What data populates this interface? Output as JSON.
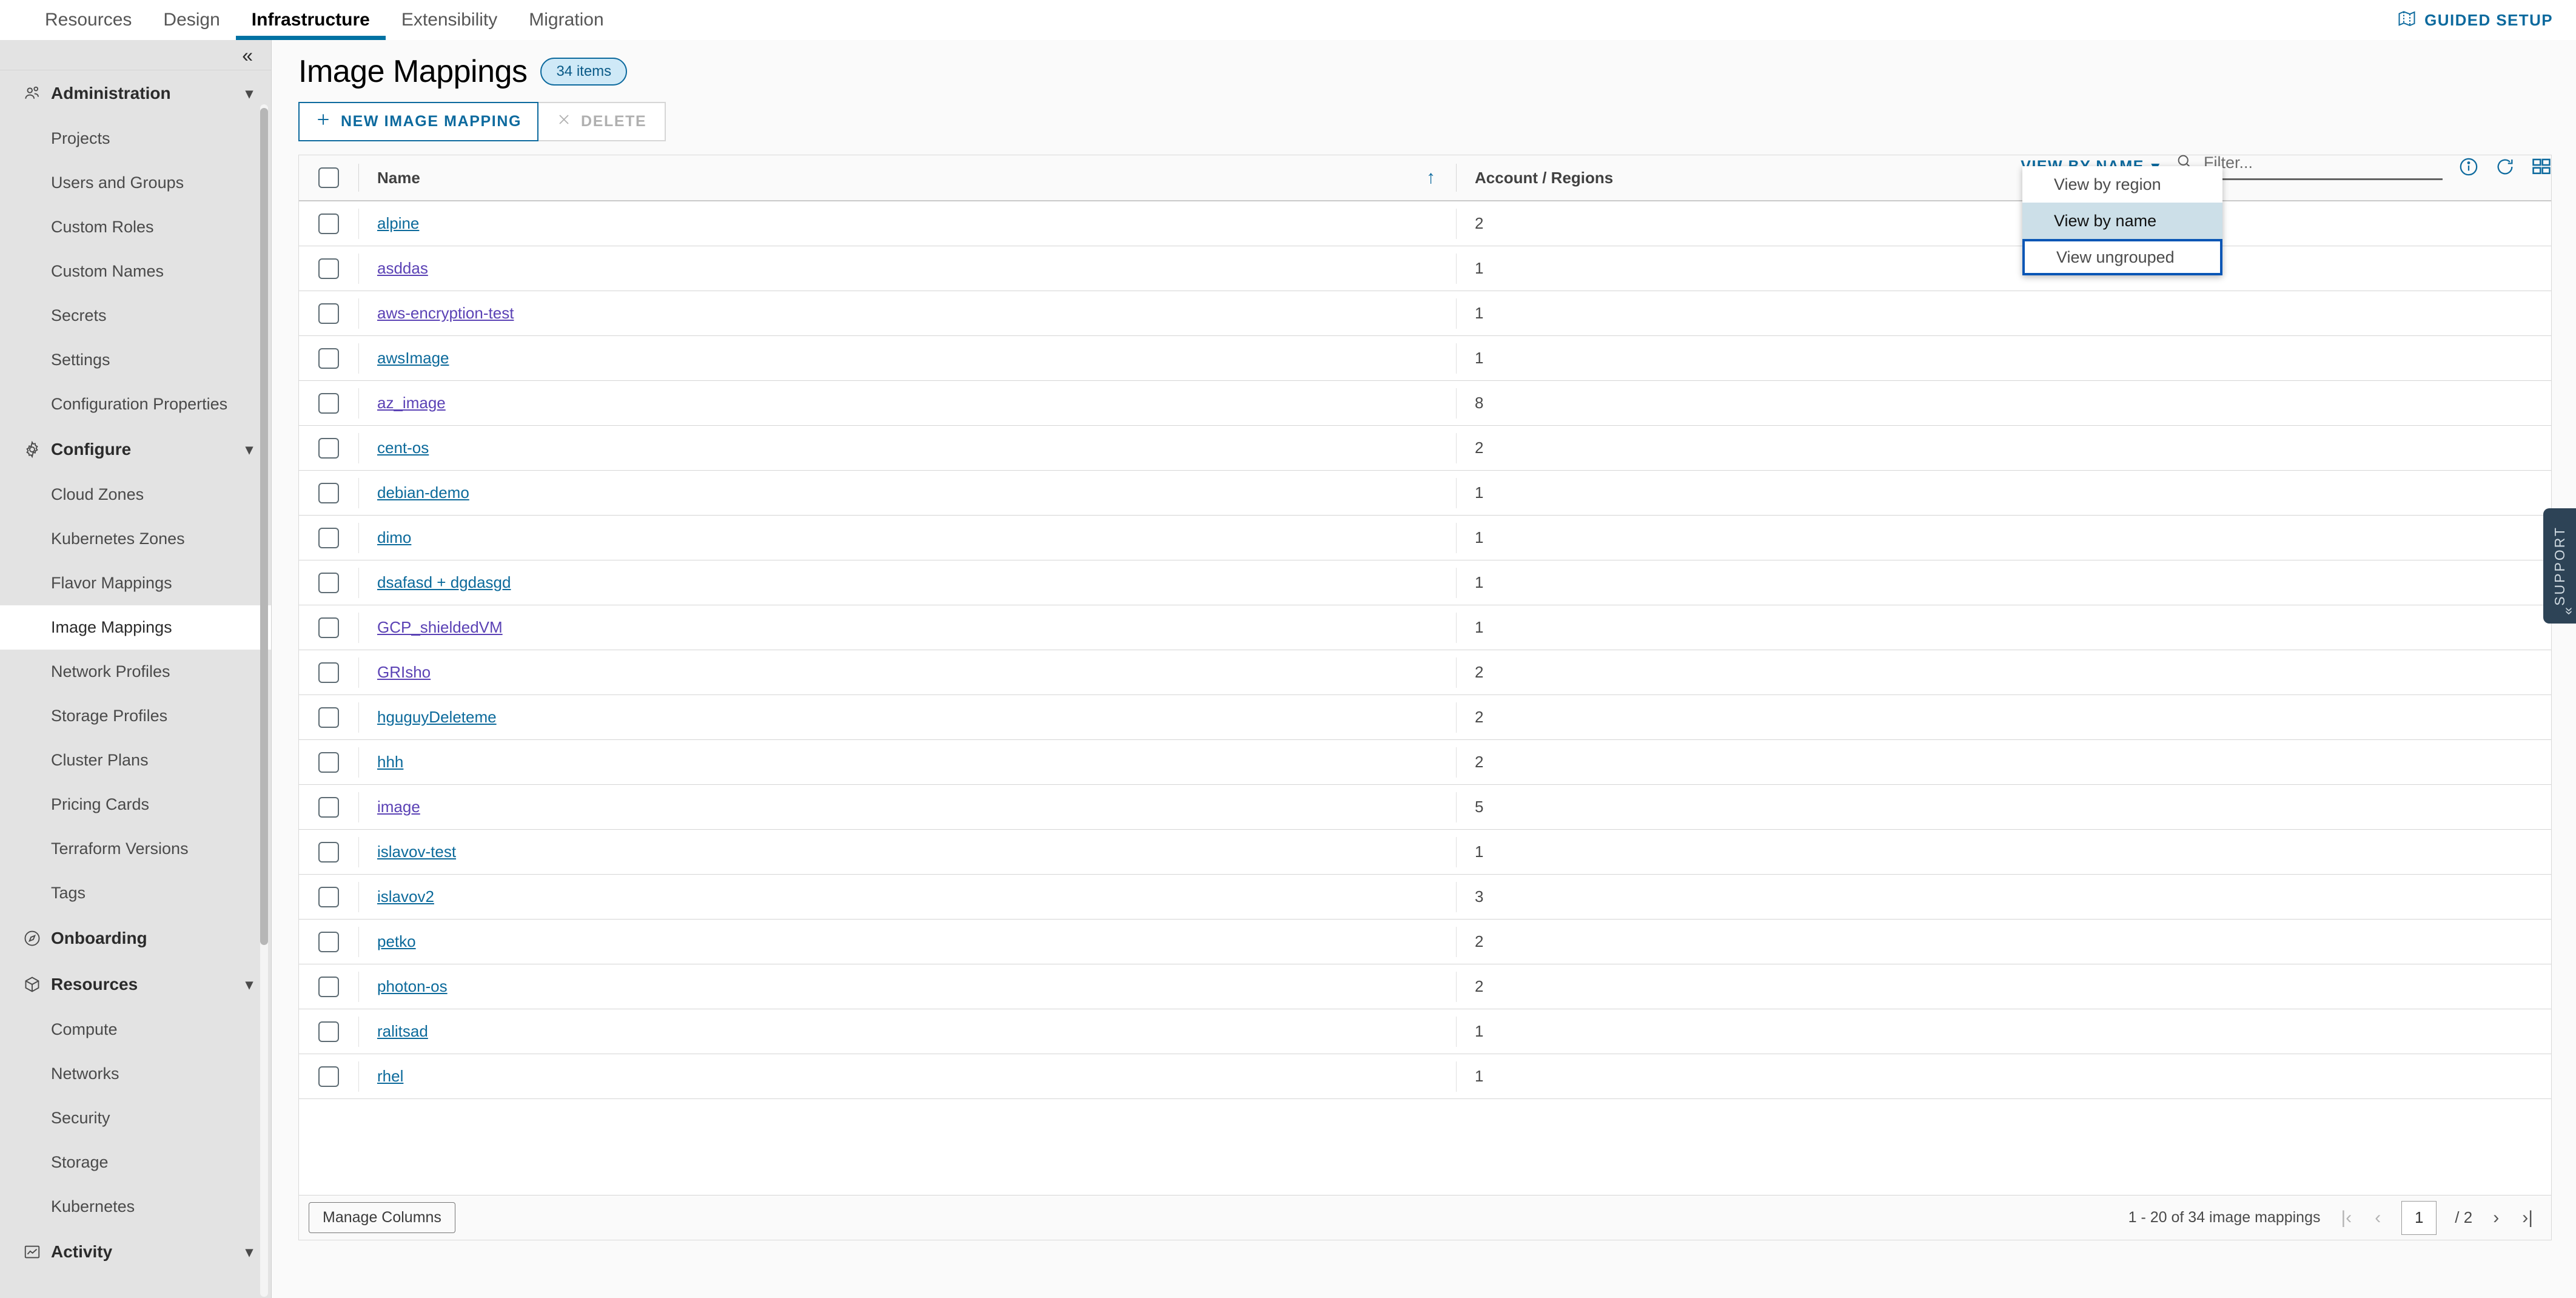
{
  "topnav": {
    "tabs": [
      {
        "label": "Resources",
        "active": false
      },
      {
        "label": "Design",
        "active": false
      },
      {
        "label": "Infrastructure",
        "active": true
      },
      {
        "label": "Extensibility",
        "active": false
      },
      {
        "label": "Migration",
        "active": false
      }
    ],
    "guided_setup_label": "GUIDED SETUP"
  },
  "sidebar": {
    "collapse_icon": "«",
    "groups": [
      {
        "label": "Administration",
        "icon": "users-icon",
        "expanded": true,
        "items": [
          {
            "label": "Projects",
            "active": false
          },
          {
            "label": "Users and Groups",
            "active": false
          },
          {
            "label": "Custom Roles",
            "active": false
          },
          {
            "label": "Custom Names",
            "active": false
          },
          {
            "label": "Secrets",
            "active": false
          },
          {
            "label": "Settings",
            "active": false
          },
          {
            "label": "Configuration Properties",
            "active": false
          }
        ]
      },
      {
        "label": "Configure",
        "icon": "gear-icon",
        "expanded": true,
        "items": [
          {
            "label": "Cloud Zones",
            "active": false
          },
          {
            "label": "Kubernetes Zones",
            "active": false
          },
          {
            "label": "Flavor Mappings",
            "active": false
          },
          {
            "label": "Image Mappings",
            "active": true
          },
          {
            "label": "Network Profiles",
            "active": false
          },
          {
            "label": "Storage Profiles",
            "active": false
          },
          {
            "label": "Cluster Plans",
            "active": false
          },
          {
            "label": "Pricing Cards",
            "active": false
          },
          {
            "label": "Terraform Versions",
            "active": false
          },
          {
            "label": "Tags",
            "active": false
          }
        ]
      },
      {
        "label": "Onboarding",
        "icon": "compass-icon",
        "expanded": false,
        "items": []
      },
      {
        "label": "Resources",
        "icon": "box-icon",
        "expanded": true,
        "items": [
          {
            "label": "Compute",
            "active": false
          },
          {
            "label": "Networks",
            "active": false
          },
          {
            "label": "Security",
            "active": false
          },
          {
            "label": "Storage",
            "active": false
          },
          {
            "label": "Kubernetes",
            "active": false
          }
        ]
      },
      {
        "label": "Activity",
        "icon": "chart-icon",
        "expanded": true,
        "items": []
      }
    ]
  },
  "page": {
    "title": "Image Mappings",
    "items_badge": "34 items",
    "new_button_label": "NEW IMAGE MAPPING",
    "new_button_icon": "plus-icon",
    "delete_button_label": "DELETE",
    "delete_button_icon": "close-x-icon"
  },
  "toolbar": {
    "view_by_label": "VIEW BY NAME",
    "view_by_chevron": "chevron-down-icon",
    "filter_placeholder": "Filter...",
    "filter_value": "",
    "search_icon": "search-icon",
    "info_icon": "info-circle-icon",
    "refresh_icon": "refresh-icon",
    "card_view_icon": "grid-view-icon"
  },
  "dropdown": {
    "open": true,
    "options": [
      {
        "label": "View by region",
        "selected": false,
        "focused": false
      },
      {
        "label": "View by name",
        "selected": true,
        "focused": false
      },
      {
        "label": "View ungrouped",
        "selected": false,
        "focused": true
      }
    ]
  },
  "table": {
    "columns": [
      "Name",
      "Account / Regions"
    ],
    "sort_column": "Name",
    "sort_direction": "asc",
    "sort_icon": "↑",
    "rows": [
      {
        "name": "alpine",
        "accounts": "2",
        "visited": false
      },
      {
        "name": "asddas",
        "accounts": "1",
        "visited": true
      },
      {
        "name": "aws-encryption-test",
        "accounts": "1",
        "visited": true
      },
      {
        "name": "awsImage",
        "accounts": "1",
        "visited": false
      },
      {
        "name": "az_image",
        "accounts": "8",
        "visited": true
      },
      {
        "name": "cent-os",
        "accounts": "2",
        "visited": false
      },
      {
        "name": "debian-demo",
        "accounts": "1",
        "visited": false
      },
      {
        "name": "dimo",
        "accounts": "1",
        "visited": false
      },
      {
        "name": "dsafasd + dgdasgd",
        "accounts": "1",
        "visited": false
      },
      {
        "name": "GCP_shieldedVM",
        "accounts": "1",
        "visited": true
      },
      {
        "name": "GRIsho",
        "accounts": "2",
        "visited": true
      },
      {
        "name": "hguguyDeleteme",
        "accounts": "2",
        "visited": false
      },
      {
        "name": "hhh",
        "accounts": "2",
        "visited": false
      },
      {
        "name": "image",
        "accounts": "5",
        "visited": true
      },
      {
        "name": "islavov-test",
        "accounts": "1",
        "visited": false
      },
      {
        "name": "islavov2",
        "accounts": "3",
        "visited": false
      },
      {
        "name": "petko",
        "accounts": "2",
        "visited": false
      },
      {
        "name": "photon-os",
        "accounts": "2",
        "visited": false
      },
      {
        "name": "ralitsad",
        "accounts": "1",
        "visited": false
      },
      {
        "name": "rhel",
        "accounts": "1",
        "visited": false
      }
    ]
  },
  "footer": {
    "manage_columns_label": "Manage Columns",
    "pager_text": "1 - 20 of 34 image mappings",
    "first_icon": "|‹",
    "prev_icon": "‹",
    "current_page": "1",
    "total_pages": "/ 2",
    "next_icon": "›",
    "last_icon": "›|"
  },
  "support": {
    "label": "SUPPORT",
    "chevron": "«"
  },
  "colors": {
    "accent": "#0d6a9e",
    "link": "#0c6a9b",
    "visited_link": "#5b42b5",
    "sidebar_bg": "#e3e3e3",
    "selected_option_bg": "#ccdfe8",
    "focus_border": "#0a56b5"
  }
}
